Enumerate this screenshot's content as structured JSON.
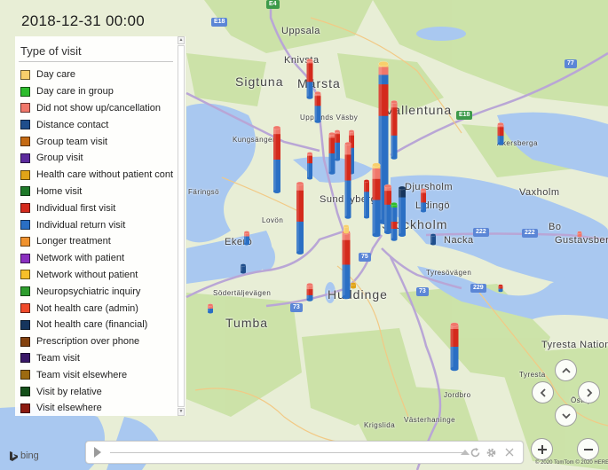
{
  "timestamp": "2018-12-31 00:00",
  "legend": {
    "title": "Type of visit",
    "items": [
      {
        "label": "Day care",
        "color": "#f8cf6c"
      },
      {
        "label": "Day care in group",
        "color": "#2ebd2e"
      },
      {
        "label": "Did not show up/cancellation",
        "color": "#f0776a"
      },
      {
        "label": "Distance contact",
        "color": "#1f4e8c"
      },
      {
        "label": "Group team visit",
        "color": "#c46a14"
      },
      {
        "label": "Group visit",
        "color": "#5c2a9d"
      },
      {
        "label": "Health care without patient contact",
        "color": "#e0a418"
      },
      {
        "label": "Home visit",
        "color": "#1f7a2a"
      },
      {
        "label": "Individual first visit",
        "color": "#d42a1c"
      },
      {
        "label": "Individual return visit",
        "color": "#2a6fc4"
      },
      {
        "label": "Longer treatment",
        "color": "#f0922e"
      },
      {
        "label": "Network with patient",
        "color": "#8a2fbf"
      },
      {
        "label": "Network without patient",
        "color": "#f7c02a"
      },
      {
        "label": "Neuropsychiatric inquiry",
        "color": "#2e9e2e"
      },
      {
        "label": "Not health care (admin)",
        "color": "#f04a2a"
      },
      {
        "label": "Not health care (financial)",
        "color": "#15355e"
      },
      {
        "label": "Prescription over phone",
        "color": "#84420f"
      },
      {
        "label": "Team visit",
        "color": "#3a1868"
      },
      {
        "label": "Team visit elsewhere",
        "color": "#9c6a10"
      },
      {
        "label": "Visit by relative",
        "color": "#14501a"
      },
      {
        "label": "Visit elsewhere",
        "color": "#8c1a10"
      }
    ]
  },
  "map": {
    "labels": [
      {
        "text": "Uppsala",
        "cls": ""
      },
      {
        "text": "Knivsta",
        "cls": ""
      },
      {
        "text": "Sigtuna",
        "cls": "big"
      },
      {
        "text": "Märsta",
        "cls": "big"
      },
      {
        "text": "Upplands Väsby",
        "cls": "small"
      },
      {
        "text": "Vallentuna",
        "cls": "big"
      },
      {
        "text": "Kungsängen",
        "cls": "small"
      },
      {
        "text": "Åkersberga",
        "cls": "small"
      },
      {
        "text": "Sundbyberg",
        "cls": ""
      },
      {
        "text": "Djursholm",
        "cls": ""
      },
      {
        "text": "Lidingö",
        "cls": ""
      },
      {
        "text": "Vaxholm",
        "cls": ""
      },
      {
        "text": "Stockholm",
        "cls": "big"
      },
      {
        "text": "Nacka",
        "cls": ""
      },
      {
        "text": "Bo",
        "cls": ""
      },
      {
        "text": "Gustavsberg",
        "cls": ""
      },
      {
        "text": "Ekerö",
        "cls": ""
      },
      {
        "text": "Huddinge",
        "cls": "big"
      },
      {
        "text": "Tumba",
        "cls": "big"
      },
      {
        "text": "Södertäljevägen",
        "cls": "small"
      },
      {
        "text": "Tyresövägen",
        "cls": "small"
      },
      {
        "text": "Tyresta Nationalpark",
        "cls": ""
      },
      {
        "text": "Tyresta",
        "cls": "small"
      },
      {
        "text": "Jordbro",
        "cls": "small"
      },
      {
        "text": "Västerhaninge",
        "cls": "small"
      },
      {
        "text": "Krigslida",
        "cls": "small"
      },
      {
        "text": "Östby",
        "cls": "small"
      },
      {
        "text": "Färingsö",
        "cls": "small"
      },
      {
        "text": "Lovön",
        "cls": "small"
      }
    ],
    "shields": [
      "E4",
      "E18",
      "E18",
      "75",
      "73",
      "73",
      "222",
      "222",
      "229",
      "77"
    ],
    "attribution": "© 2020 TomTom © 2020 HERE"
  },
  "timeline": {
    "play_label": "Play",
    "progress": 1.0
  },
  "controls": {
    "bing_label": "bing",
    "pan_up": "Pan up",
    "pan_left": "Pan left",
    "pan_right": "Pan right",
    "pan_down": "Pan down",
    "zoom_in": "Zoom in",
    "zoom_out": "Zoom out"
  }
}
